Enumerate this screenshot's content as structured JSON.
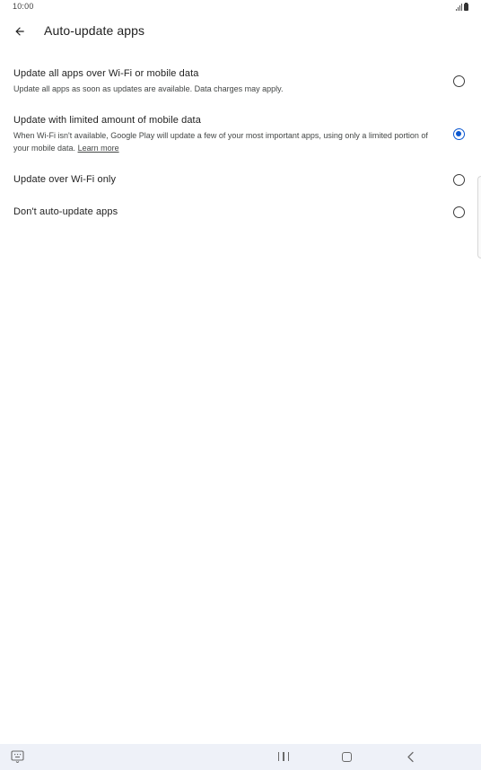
{
  "status_bar": {
    "time": "10:00",
    "signal_icon": "signal-bars-icon",
    "battery_icon": "battery-icon"
  },
  "app_bar": {
    "back_icon": "arrow-back-icon",
    "title": "Auto-update apps"
  },
  "options": [
    {
      "title": "Update all apps over Wi-Fi or mobile data",
      "description": "Update all apps as soon as updates are available. Data charges may apply.",
      "selected": false
    },
    {
      "title": "Update with limited amount of mobile data",
      "description": "When Wi-Fi isn't available, Google Play will update a few of your most important apps, using only a limited portion of your mobile data.",
      "link": "Learn more",
      "selected": true
    },
    {
      "title": "Update over Wi-Fi only",
      "selected": false
    },
    {
      "title": "Don't auto-update apps",
      "selected": false
    }
  ],
  "nav_bar": {
    "keyboard_icon": "keyboard-icon",
    "recents_icon": "recents-icon",
    "home_icon": "home-icon",
    "back_icon": "nav-back-icon"
  },
  "colors": {
    "accent": "#0b57d0",
    "nav_background": "#eef1f8",
    "text_primary": "#1f1f1f",
    "text_secondary": "#444746"
  }
}
